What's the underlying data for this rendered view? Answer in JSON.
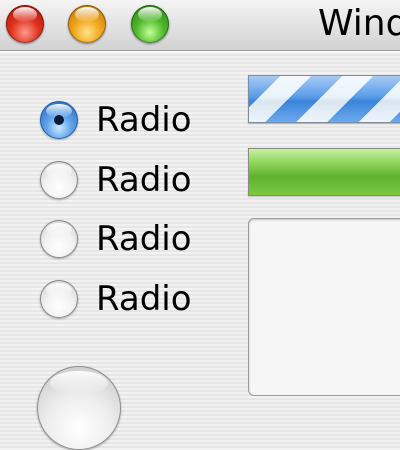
{
  "window": {
    "title": "Wind"
  },
  "titlebar": {
    "buttons": [
      {
        "name": "close-button",
        "color": "#e0321e"
      },
      {
        "name": "minimize-button",
        "color": "#f0a41a"
      },
      {
        "name": "zoom-button",
        "color": "#4fb82c"
      }
    ]
  },
  "radios": [
    {
      "label": "Radio",
      "selected": true
    },
    {
      "label": "Radio",
      "selected": false
    },
    {
      "label": "Radio",
      "selected": false
    },
    {
      "label": "Radio",
      "selected": false
    }
  ],
  "progress": {
    "indeterminate_color": "#3d8be6",
    "determinate_fraction": 1.0,
    "determinate_color": "#5fb230"
  }
}
